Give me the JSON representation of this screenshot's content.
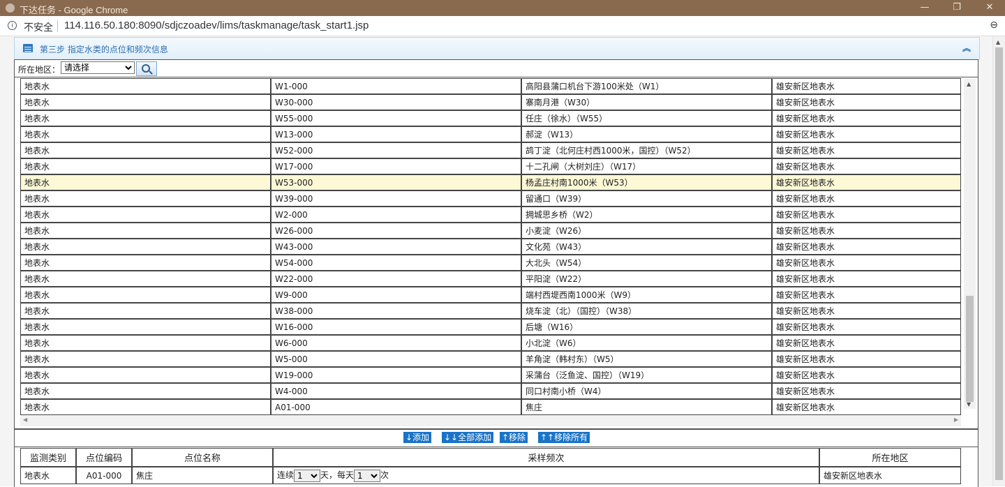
{
  "window": {
    "title": "下达任务 - Google Chrome",
    "minimize": "—",
    "restore": "❐",
    "close": "✕"
  },
  "address": {
    "info_icon": "i",
    "security": "不安全",
    "url": "114.116.50.180:8090/sdjczoadev/lims/taskmanage/task_start1.jsp",
    "zoom_icon": "⊖"
  },
  "panel": {
    "title": "第三步 指定水类的点位和频次信息",
    "collapse_icon": "︽"
  },
  "filter": {
    "label": "所在地区：",
    "selected": "请选择"
  },
  "top_rows": [
    {
      "type": "地表水",
      "code": "W1-000",
      "name": "高阳县蒲口机台下游100米处（W1）",
      "area": "雄安新区地表水",
      "selected": false
    },
    {
      "type": "地表水",
      "code": "W30-000",
      "name": "寨南月港（W30）",
      "area": "雄安新区地表水",
      "selected": false
    },
    {
      "type": "地表水",
      "code": "W55-000",
      "name": "任庄（徐水）（W55）",
      "area": "雄安新区地表水",
      "selected": false
    },
    {
      "type": "地表水",
      "code": "W13-000",
      "name": "郝淀（W13）",
      "area": "雄安新区地表水",
      "selected": false
    },
    {
      "type": "地表水",
      "code": "W52-000",
      "name": "鸪丁淀（北何庄村西1000米，国控）（W52）",
      "area": "雄安新区地表水",
      "selected": false
    },
    {
      "type": "地表水",
      "code": "W17-000",
      "name": "十二孔闸（大树刘庄）（W17）",
      "area": "雄安新区地表水",
      "selected": false
    },
    {
      "type": "地表水",
      "code": "W53-000",
      "name": "杨孟庄村南1000米（W53）",
      "area": "雄安新区地表水",
      "selected": true
    },
    {
      "type": "地表水",
      "code": "W39-000",
      "name": "留通口（W39）",
      "area": "雄安新区地表水",
      "selected": false
    },
    {
      "type": "地表水",
      "code": "W2-000",
      "name": "拥城思乡桥（W2）",
      "area": "雄安新区地表水",
      "selected": false
    },
    {
      "type": "地表水",
      "code": "W26-000",
      "name": "小麦淀（W26）",
      "area": "雄安新区地表水",
      "selected": false
    },
    {
      "type": "地表水",
      "code": "W43-000",
      "name": "文化苑（W43）",
      "area": "雄安新区地表水",
      "selected": false
    },
    {
      "type": "地表水",
      "code": "W54-000",
      "name": "大北头（W54）",
      "area": "雄安新区地表水",
      "selected": false
    },
    {
      "type": "地表水",
      "code": "W22-000",
      "name": "平阳淀（W22）",
      "area": "雄安新区地表水",
      "selected": false
    },
    {
      "type": "地表水",
      "code": "W9-000",
      "name": "端村西堤西南1000米（W9）",
      "area": "雄安新区地表水",
      "selected": false
    },
    {
      "type": "地表水",
      "code": "W38-000",
      "name": "烧车淀（北）（国控）（W38）",
      "area": "雄安新区地表水",
      "selected": false
    },
    {
      "type": "地表水",
      "code": "W16-000",
      "name": "后塘（W16）",
      "area": "雄安新区地表水",
      "selected": false
    },
    {
      "type": "地表水",
      "code": "W6-000",
      "name": "小北淀（W6）",
      "area": "雄安新区地表水",
      "selected": false
    },
    {
      "type": "地表水",
      "code": "W5-000",
      "name": "羊角淀（韩村东）（W5）",
      "area": "雄安新区地表水",
      "selected": false
    },
    {
      "type": "地表水",
      "code": "W19-000",
      "name": "采蒲台（泛鱼淀、国控）（W19）",
      "area": "雄安新区地表水",
      "selected": false
    },
    {
      "type": "地表水",
      "code": "W4-000",
      "name": "同口村南小桥（W4）",
      "area": "雄安新区地表水",
      "selected": false
    },
    {
      "type": "地表水",
      "code": "A01-000",
      "name": "焦庄",
      "area": "雄安新区地表水",
      "selected": false
    }
  ],
  "actions": {
    "add": "↓添加",
    "add_all": "↓↓全部添加",
    "remove": "↑移除",
    "remove_all": "↑↑移除所有"
  },
  "bottom": {
    "headers": {
      "type": "监测类别",
      "code": "点位编码",
      "name": "点位名称",
      "freq": "采样频次",
      "area": "所在地区"
    },
    "rows": [
      {
        "type": "地表水",
        "code": "A01-000",
        "name": "焦庄",
        "freq_prefix": "连续",
        "days": "1",
        "freq_mid": "天，每天",
        "times": "1",
        "freq_suffix": "次",
        "area": "雄安新区地表水"
      }
    ]
  }
}
